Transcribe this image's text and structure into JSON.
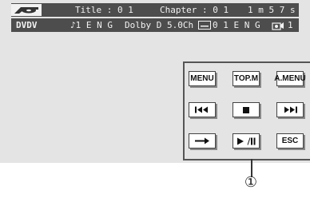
{
  "status_bar": {
    "title_label": "Title : 0 1",
    "chapter_label": "Chapter : 0 1",
    "elapsed_time": "1 m 5 7 s"
  },
  "audio_bar": {
    "source": "DVDV",
    "audio_track": "♪1 E N G",
    "audio_format": "Dolby D 5.0Ch",
    "subtitle": "0 1 E N G",
    "angle": "1"
  },
  "controls": {
    "menu": "MENU",
    "top_menu": "TOP.M",
    "audio_menu": "A.MENU",
    "escape": "ESC"
  },
  "callout": {
    "number": "①"
  }
}
